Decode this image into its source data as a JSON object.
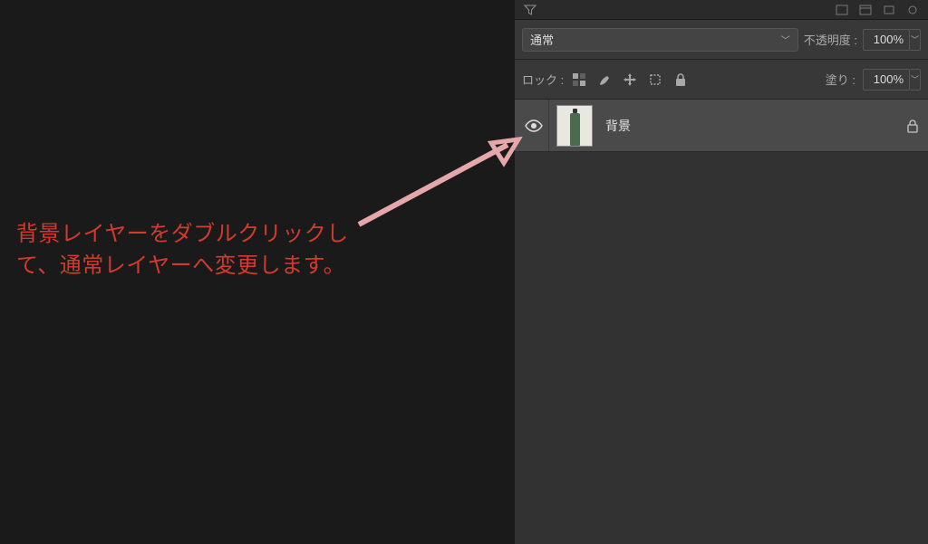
{
  "instruction": "背景レイヤーをダブルクリックして、通常レイヤーへ変更します。",
  "panel": {
    "blend_mode_label": "通常",
    "opacity_label": "不透明度 :",
    "opacity_value": "100%",
    "lock_label": "ロック :",
    "fill_label": "塗り :",
    "fill_value": "100%"
  },
  "layer": {
    "name": "背景"
  },
  "icons": {
    "eye": "eye-icon",
    "lock": "lock-icon",
    "pixels": "lock-pixels-icon",
    "brush": "lock-brush-icon",
    "move": "lock-move-icon",
    "artboard": "lock-artboard-icon",
    "lockall": "lock-all-icon"
  }
}
